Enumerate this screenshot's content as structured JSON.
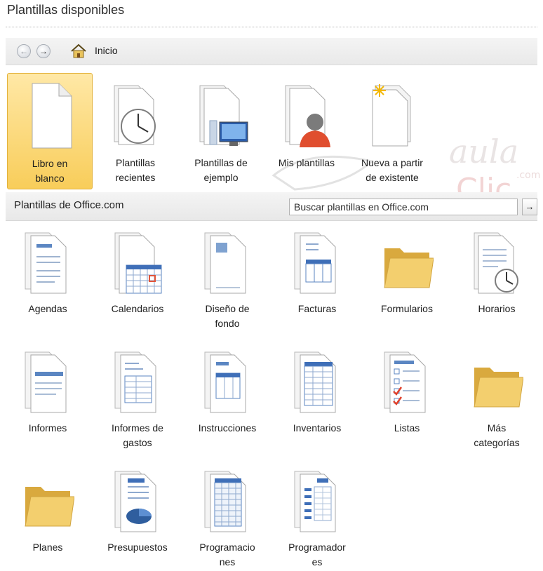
{
  "header": {
    "title": "Plantillas disponibles"
  },
  "nav": {
    "home_label": "Inicio"
  },
  "featured": [
    {
      "label": "Libro en\nblanco",
      "icon": "blank-workbook-icon",
      "selected": true
    },
    {
      "label": "Plantillas\nrecientes",
      "icon": "recent-templates-icon",
      "selected": false
    },
    {
      "label": "Plantillas de\nejemplo",
      "icon": "sample-templates-icon",
      "selected": false
    },
    {
      "label": "Mis plantillas",
      "icon": "my-templates-icon",
      "selected": false
    },
    {
      "label": "Nueva a partir\nde existente",
      "icon": "new-from-existing-icon",
      "selected": false
    }
  ],
  "office": {
    "section_label": "Plantillas de Office.com",
    "search_placeholder": "Buscar plantillas en Office.com"
  },
  "categories": [
    {
      "label": "Agendas",
      "icon": "agenda-doc-icon"
    },
    {
      "label": "Calendarios",
      "icon": "calendar-doc-icon"
    },
    {
      "label": "Diseño de\nfondo",
      "icon": "background-doc-icon"
    },
    {
      "label": "Facturas",
      "icon": "invoice-doc-icon"
    },
    {
      "label": "Formularios",
      "icon": "folder-icon"
    },
    {
      "label": "Horarios",
      "icon": "schedule-doc-icon"
    },
    {
      "label": "Informes",
      "icon": "report-doc-icon"
    },
    {
      "label": "Informes de\ngastos",
      "icon": "expense-report-doc-icon"
    },
    {
      "label": "Instrucciones",
      "icon": "instructions-doc-icon"
    },
    {
      "label": "Inventarios",
      "icon": "inventory-doc-icon"
    },
    {
      "label": "Listas",
      "icon": "checklist-doc-icon"
    },
    {
      "label": "Más\ncategorías",
      "icon": "folder-icon"
    },
    {
      "label": "Planes",
      "icon": "folder-icon"
    },
    {
      "label": "Presupuestos",
      "icon": "budget-doc-icon"
    },
    {
      "label": "Programacio\nnes",
      "icon": "programming-doc-icon"
    },
    {
      "label": "Programador\nes",
      "icon": "planner-doc-icon"
    }
  ],
  "colors": {
    "selected_tile": "#f8cd5a",
    "folder": "#f0c75e",
    "doc_accent": "#5b86c2"
  },
  "watermark": {
    "line1": "aula",
    "line2": "Clic",
    "line3": ".com"
  }
}
